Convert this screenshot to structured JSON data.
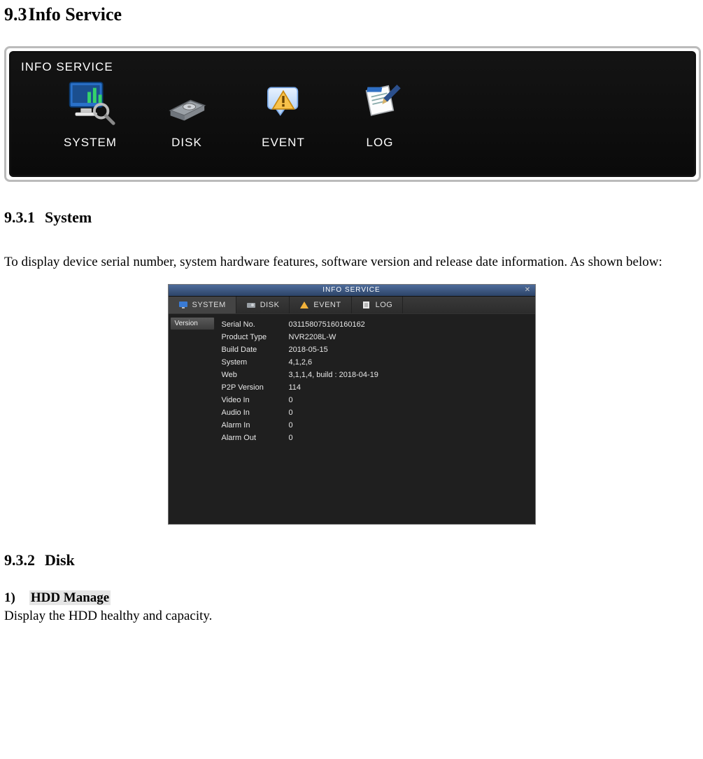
{
  "heading1": {
    "num": "9.3",
    "text": "Info Service"
  },
  "panel1": {
    "title": "INFO SERVICE",
    "icons": [
      "SYSTEM",
      "DISK",
      "EVENT",
      "LOG"
    ]
  },
  "section_system": {
    "num": "9.3.1",
    "title": "System",
    "para": "To display device serial number, system hardware features, software version and release date information. As shown below:"
  },
  "panel2": {
    "title": "INFO SERVICE",
    "tabs": [
      "SYSTEM",
      "DISK",
      "EVENT",
      "LOG"
    ],
    "side": "Version",
    "rows": [
      {
        "k": "Serial No.",
        "v": "031158075160160162"
      },
      {
        "k": "Product Type",
        "v": "NVR2208L-W"
      },
      {
        "k": "Build Date",
        "v": "2018-05-15"
      },
      {
        "k": "System",
        "v": "4,1,2,6"
      },
      {
        "k": "Web",
        "v": "3,1,1,4, build : 2018-04-19"
      },
      {
        "k": "P2P Version",
        "v": "114"
      },
      {
        "k": "Video In",
        "v": "0"
      },
      {
        "k": "Audio In",
        "v": "0"
      },
      {
        "k": "Alarm In",
        "v": "0"
      },
      {
        "k": "Alarm Out",
        "v": "0"
      }
    ]
  },
  "section_disk": {
    "num": "9.3.2",
    "title": "Disk",
    "item_num": "1)",
    "item_label": "HDD Manage",
    "item_text": "Display the HDD healthy and capacity."
  }
}
